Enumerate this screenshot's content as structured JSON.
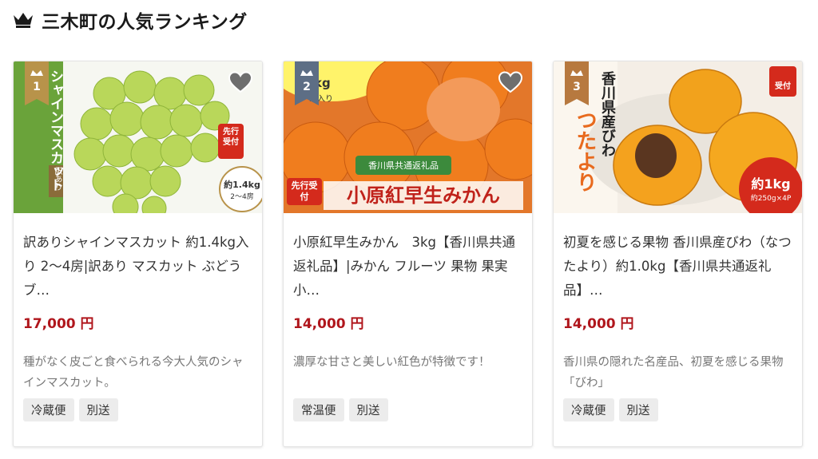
{
  "page": {
    "heading": "三木町の人気ランキング"
  },
  "colors": {
    "price": "#b0161c",
    "rank_gold": "#b8934a",
    "rank_slate": "#5d6e85",
    "rank_bronze": "#b7793f"
  },
  "items": [
    {
      "rank": "1",
      "title": "訳ありシャインマスカット 約1.4kg入り 2〜4房|訳あり マスカット ぶどう ブ…",
      "price": "17,000 円",
      "desc": "種がなく皮ごと食べられる今大人気のシャインマスカット。",
      "tags": [
        "冷蔵便",
        "別送"
      ],
      "img": {
        "main": "シャインマスカット",
        "sub": "訳あり",
        "badge": "先行受付",
        "weight": "約1.4kg",
        "count": "2〜4房"
      }
    },
    {
      "rank": "2",
      "title": "小原紅早生みかん　3kg【香川県共通返礼品】|みかん フルーツ 果物 果実 小…",
      "price": "14,000 円",
      "desc": "濃厚な甘さと美しい紅色が特徴です！",
      "tags": [
        "常温便",
        "別送"
      ],
      "img": {
        "main": "小原紅早生みかん",
        "sub": "香川県共通返礼品",
        "badge": "先行受付",
        "weight": "kg",
        "count": "ル入り"
      }
    },
    {
      "rank": "3",
      "title": "初夏を感じる果物 香川県産びわ（なつたより）約1.0kg【香川県共通返礼品】…",
      "price": "14,000 円",
      "desc": "香川県の隠れた名産品、初夏を感じる果物「びわ」",
      "tags": [
        "冷蔵便",
        "別送"
      ],
      "img": {
        "main": "香川県産びわ",
        "sub": "つたより",
        "badge": "受付",
        "weight": "約1kg",
        "count": "約250g×4P"
      }
    }
  ]
}
